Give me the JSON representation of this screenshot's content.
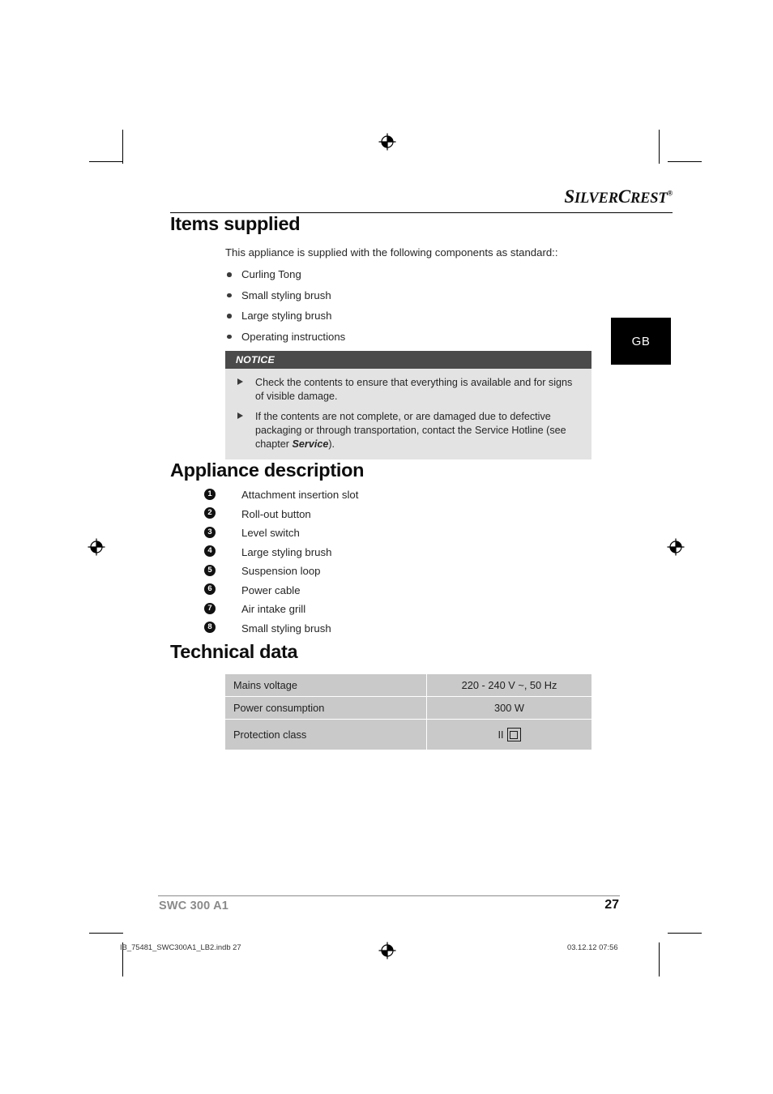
{
  "brand": {
    "name_part1": "S",
    "name_part2": "ILVER",
    "name_part3": "C",
    "name_part4": "REST",
    "trademark": "®"
  },
  "language_tab": {
    "label": "GB"
  },
  "sections": {
    "items_supplied": {
      "heading": "Items supplied",
      "intro": "This appliance is supplied with the following components as standard::",
      "bullets": [
        "Curling Tong",
        "Small styling brush",
        "Large styling brush",
        "Operating instructions"
      ],
      "notice": {
        "title": "NOTICE",
        "items": [
          {
            "text_before": "Check the contents to ensure that everything is available and for signs of visible damage.",
            "bold": "",
            "text_after": ""
          },
          {
            "text_before": "If the contents are not complete, or are damaged due to defective packaging or through transportation, contact the Service Hotline (see chapter ",
            "bold": "Service",
            "text_after": ")."
          }
        ]
      }
    },
    "appliance_description": {
      "heading": "Appliance description",
      "parts": [
        {
          "number": "1",
          "label": "Attachment insertion slot"
        },
        {
          "number": "2",
          "label": "Roll-out button"
        },
        {
          "number": "3",
          "label": "Level switch"
        },
        {
          "number": "4",
          "label": "Large styling brush"
        },
        {
          "number": "5",
          "label": "Suspension loop"
        },
        {
          "number": "6",
          "label": "Power cable"
        },
        {
          "number": "7",
          "label": "Air intake grill"
        },
        {
          "number": "8",
          "label": "Small styling brush"
        }
      ]
    },
    "technical_data": {
      "heading": "Technical data",
      "rows": [
        {
          "label": "Mains voltage",
          "value": "220 - 240 V ~, 50 Hz"
        },
        {
          "label": "Power consumption",
          "value": "300 W"
        },
        {
          "label": "Protection class",
          "value": "II"
        }
      ]
    }
  },
  "footer": {
    "model": "SWC 300 A1",
    "page_number": "27"
  },
  "slug": {
    "file": "IB_75481_SWC300A1_LB2.indb   27",
    "date_time": "03.12.12   07:56"
  },
  "colors": {
    "notice_header_bg": "#4a4a4a",
    "notice_body_bg": "#e3e3e3",
    "table_cell_bg": "#c9c9c9",
    "footer_model_text": "#8a8a8a",
    "tab_bg": "#000000"
  }
}
